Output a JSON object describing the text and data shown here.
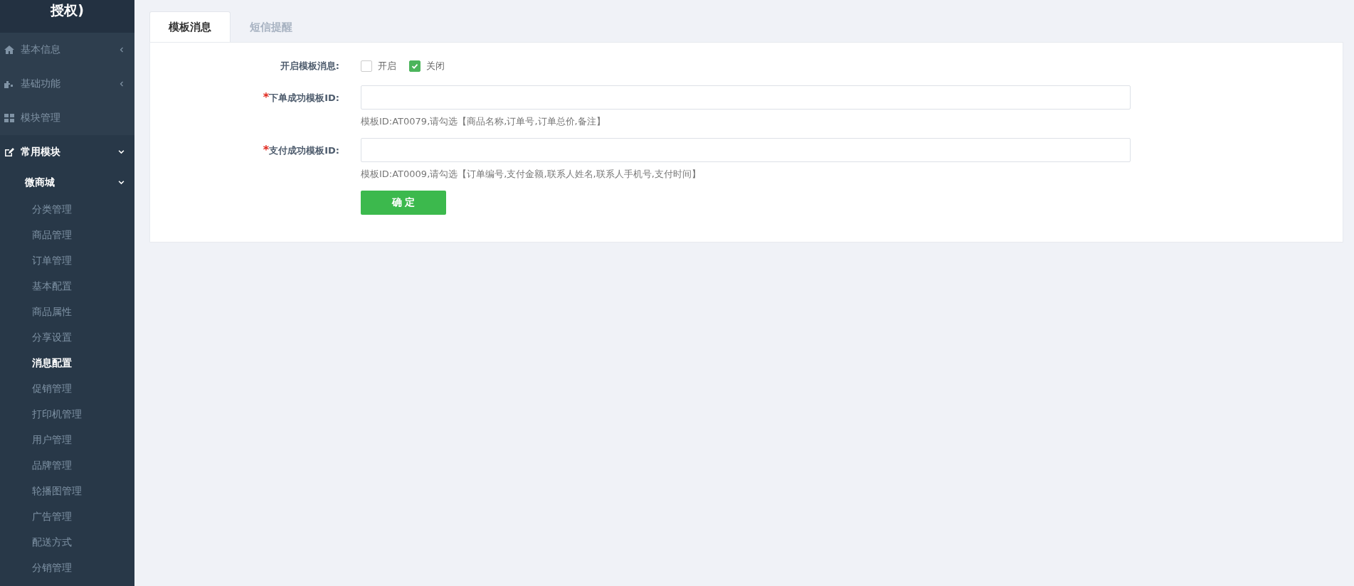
{
  "sidebar": {
    "brand": "授权)",
    "items": [
      {
        "label": "基本信息",
        "kind": "group",
        "expanded": false
      },
      {
        "label": "基础功能",
        "kind": "group",
        "expanded": false
      },
      {
        "label": "模块管理",
        "kind": "link",
        "expanded": false
      },
      {
        "label": "常用模块",
        "kind": "group",
        "expanded": true,
        "children": [
          {
            "label": "微商城",
            "expanded": true,
            "children": [
              {
                "label": "分类管理",
                "selected": false
              },
              {
                "label": "商品管理",
                "selected": false
              },
              {
                "label": "订单管理",
                "selected": false
              },
              {
                "label": "基本配置",
                "selected": false
              },
              {
                "label": "商品属性",
                "selected": false
              },
              {
                "label": "分享设置",
                "selected": false
              },
              {
                "label": "消息配置",
                "selected": true
              },
              {
                "label": "促销管理",
                "selected": false
              },
              {
                "label": "打印机管理",
                "selected": false
              },
              {
                "label": "用户管理",
                "selected": false
              },
              {
                "label": "品牌管理",
                "selected": false
              },
              {
                "label": "轮播图管理",
                "selected": false
              },
              {
                "label": "广告管理",
                "selected": false
              },
              {
                "label": "配送方式",
                "selected": false
              },
              {
                "label": "分销管理",
                "selected": false
              }
            ]
          }
        ]
      }
    ]
  },
  "tabs": [
    {
      "label": "模板消息",
      "selected": true
    },
    {
      "label": "短信提醒",
      "selected": false
    }
  ],
  "form": {
    "toggle": {
      "label": "开启模板消息:",
      "options": [
        {
          "label": "开启",
          "checked": false
        },
        {
          "label": "关闭",
          "checked": true
        }
      ]
    },
    "fields": [
      {
        "required_mark": "*",
        "label": "下单成功模板ID:",
        "hint": "模板ID:AT0079,请勾选【商品名称,订单号,订单总价,备注】"
      },
      {
        "required_mark": "*",
        "label": "支付成功模板ID:",
        "hint": "模板ID:AT0009,请勾选【订单编号,支付金额,联系人姓名,联系人手机号,支付时间】"
      }
    ],
    "submit": "确 定"
  }
}
